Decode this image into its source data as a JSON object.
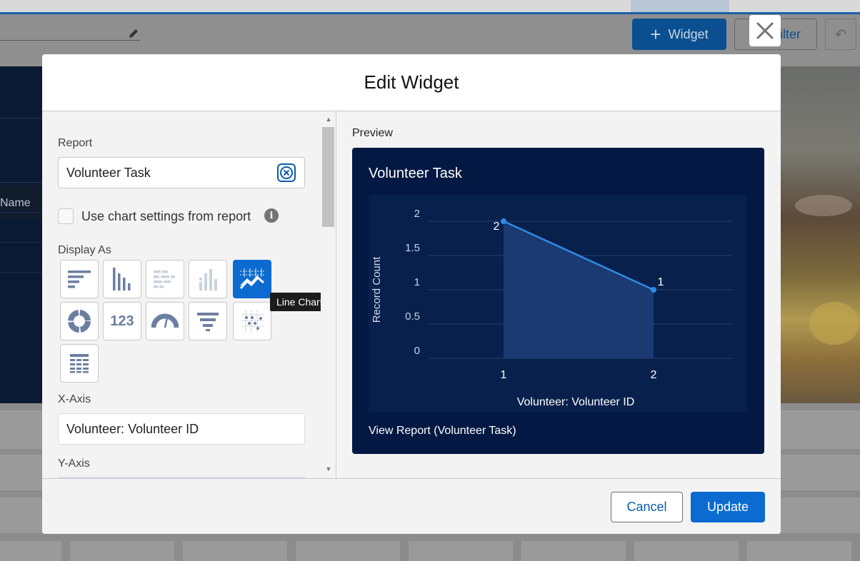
{
  "background": {
    "widget_button": "Widget",
    "filter_button_partial": "ilter",
    "table_header_partial": "Name"
  },
  "modal": {
    "title": "Edit Widget",
    "report_label": "Report",
    "report_value": "Volunteer Task",
    "use_chart_settings_label": "Use chart settings from report",
    "use_chart_settings_checked": false,
    "display_as_label": "Display As",
    "chart_types": [
      {
        "name": "horizontal-bar-chart",
        "selected": false
      },
      {
        "name": "vertical-bar-chart",
        "selected": false
      },
      {
        "name": "stacked-horizontal-bar-chart",
        "selected": false
      },
      {
        "name": "stacked-vertical-bar-chart",
        "selected": false
      },
      {
        "name": "line-chart",
        "selected": true
      },
      {
        "name": "donut-chart",
        "selected": false
      },
      {
        "name": "metric-chart",
        "selected": false
      },
      {
        "name": "gauge-chart",
        "selected": false
      },
      {
        "name": "funnel-chart",
        "selected": false
      },
      {
        "name": "scatter-chart",
        "selected": false
      },
      {
        "name": "lightning-table",
        "selected": false
      }
    ],
    "tooltip": "Line Chart",
    "x_axis_label": "X-Axis",
    "x_axis_value": "Volunteer: Volunteer ID",
    "y_axis_label": "Y-Axis",
    "preview_label": "Preview",
    "card_title": "Volunteer Task",
    "view_report_link": "View Report (Volunteer Task)",
    "cancel_button": "Cancel",
    "update_button": "Update"
  },
  "colors": {
    "accent": "#0b6bd1",
    "card_bg": "#031842",
    "line": "#2f8be6"
  },
  "chart_data": {
    "type": "line",
    "x": [
      "1",
      "2"
    ],
    "series": [
      {
        "values": [
          2,
          1
        ]
      }
    ],
    "data_labels": [
      "2",
      "1"
    ],
    "xlabel": "Volunteer: Volunteer ID",
    "ylabel": "Record Count",
    "ylim": [
      0,
      2
    ],
    "yticks": [
      "0",
      "0.5",
      "1",
      "1.5",
      "2"
    ],
    "grid": true,
    "area_fill": true
  }
}
